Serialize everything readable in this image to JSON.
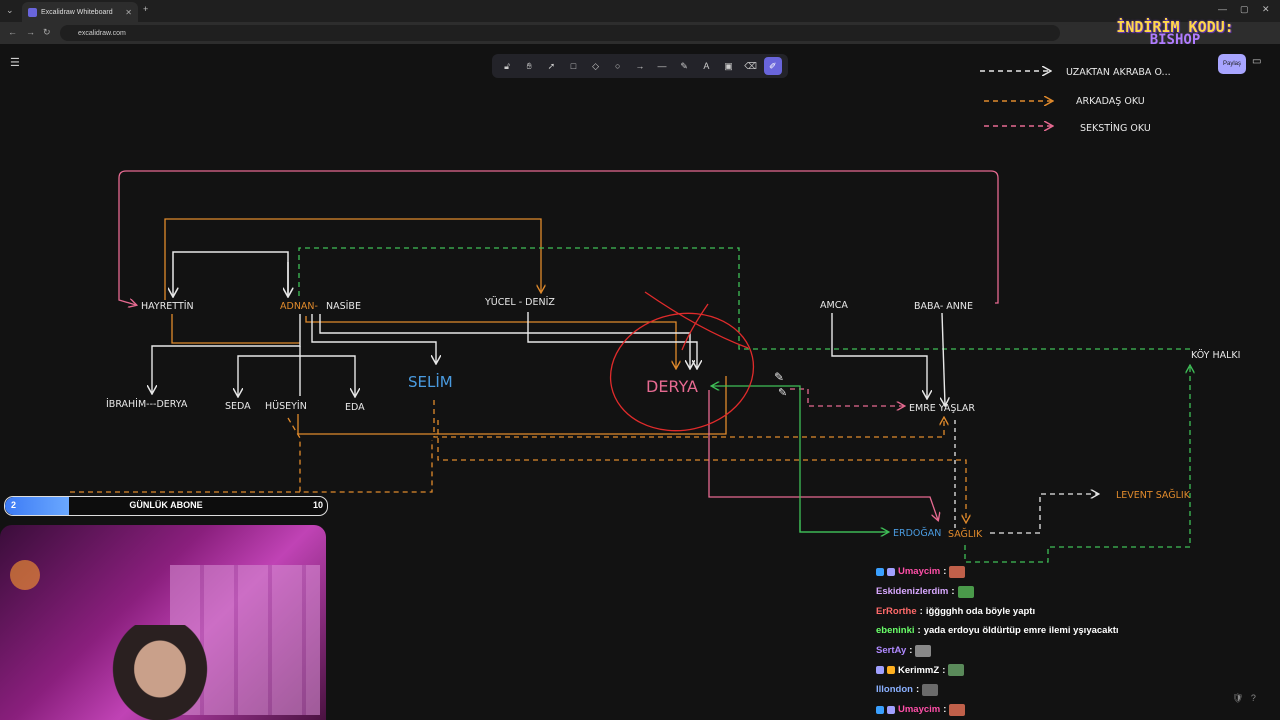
{
  "browser": {
    "tab_title": "Excalidraw Whiteboard",
    "url": "excalidraw.com",
    "window_controls": [
      "—",
      "▢",
      "✕"
    ]
  },
  "toolbar": {
    "tools": [
      "lock-icon",
      "hand-icon",
      "pointer-icon",
      "rectangle-icon",
      "diamond-icon",
      "ellipse-icon",
      "arrow-icon",
      "line-icon",
      "pencil-icon",
      "text-icon",
      "image-icon",
      "eraser-icon",
      "laser-icon"
    ],
    "active_tool": "laser-icon",
    "share_label": "Paylaş"
  },
  "promo": {
    "line1": "İNDİRİM KODU:",
    "line2": "BISHOP"
  },
  "legend": [
    {
      "label": "UZAKTAN AKRABA O...",
      "color": "#ffffff"
    },
    {
      "label": "ARKADAŞ OKU",
      "color": "#e08a2c"
    },
    {
      "label": "SEKSTİNG OKU",
      "color": "#e66a91"
    }
  ],
  "diagram": {
    "nodes": {
      "hayrettin": "HAYRETTİN",
      "adnan": "ADNAN-",
      "nasibe": "NASİBE",
      "yucel_deniz": "YÜCEL - DENİZ",
      "amca": "AMCA",
      "baba_anne": "BABA- ANNE",
      "koy_halki": "KÖY HALKI",
      "ibrahim_derya": "İBRAHİM---DERYA",
      "seda": "SEDA",
      "huseyin": "HÜSEYİN",
      "eda": "EDA",
      "selim": "SELİM",
      "derya": "DERYA",
      "emre_yaslar": "EMRE YAŞLAR",
      "levent_saglik": "LEVENT SAĞLIK",
      "erdogan": "ERDOĞAN",
      "saglik": "SAĞLIK"
    },
    "colors": {
      "family": "#e8e8e8",
      "friend": "#e08a2c",
      "sexting": "#e66a91",
      "green": "#3fbf57",
      "red": "#e02b2b",
      "blue": "#4a9be0"
    }
  },
  "subscriber_goal": {
    "label": "GÜNLÜK ABONE",
    "current": "2",
    "goal": "10",
    "progress": 0.2
  },
  "chat": [
    {
      "user": "Umaycim",
      "color": "#ff4fa8",
      "text": "",
      "emote": "#c0604a",
      "badges": [
        "#3aa0ff",
        "#a0a0ff"
      ]
    },
    {
      "user": "Eskidenizlerdim",
      "color": "#d8a8ff",
      "text": "",
      "emote": "#4a9a4a",
      "badges": []
    },
    {
      "user": "ErRorthe",
      "color": "#ff6a6a",
      "text": "iğğgghh oda böyle yaptı",
      "emote": "",
      "badges": []
    },
    {
      "user": "ebeninki",
      "color": "#6aff6a",
      "text": "yada erdoyu öldürtüp emre ilemi yşıyacaktı",
      "emote": "",
      "badges": []
    },
    {
      "user": "SertAy",
      "color": "#b08aff",
      "text": "",
      "emote": "#888888",
      "badges": []
    },
    {
      "user": "KerimmZ",
      "color": "#ffffff",
      "text": "",
      "emote": "#5a8a5a",
      "badges": [
        "#a0a0ff",
        "#ffb020"
      ]
    },
    {
      "user": "Illondon",
      "color": "#8ab0ff",
      "text": "",
      "emote": "#6a6a6a",
      "badges": []
    },
    {
      "user": "Umaycim",
      "color": "#ff4fa8",
      "text": "",
      "emote": "#c0604a",
      "badges": [
        "#3aa0ff",
        "#a0a0ff"
      ]
    }
  ]
}
